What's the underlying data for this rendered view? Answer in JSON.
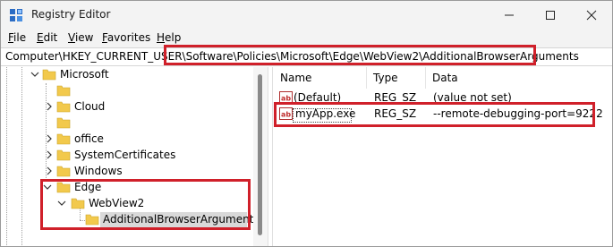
{
  "window": {
    "title": "Registry Editor",
    "app_icon": "registry-editor-icon"
  },
  "menu": {
    "items": [
      "File",
      "Edit",
      "View",
      "Favorites",
      "Help"
    ]
  },
  "address": {
    "path": "Computer\\HKEY_CURRENT_USER\\Software\\Policies\\Microsoft\\Edge\\WebView2\\AdditionalBrowserArguments"
  },
  "tree": {
    "items": [
      {
        "label": "Microsoft",
        "expanded": true
      },
      {
        "label": ""
      },
      {
        "label": "Cloud",
        "collapsed": true
      },
      {
        "label": ""
      },
      {
        "label": "office",
        "collapsed": true
      },
      {
        "label": "SystemCertificates",
        "collapsed": true
      },
      {
        "label": "Windows",
        "collapsed": true
      },
      {
        "label": "Edge",
        "expanded": true
      },
      {
        "label": "WebView2",
        "expanded": true
      },
      {
        "label": "AdditionalBrowserArguments",
        "selected": true
      }
    ]
  },
  "list": {
    "columns": [
      "Name",
      "Type",
      "Data"
    ],
    "rows": [
      {
        "name": "(Default)",
        "type": "REG_SZ",
        "data": "(value not set)",
        "icon": "string-value-icon"
      },
      {
        "name": "myApp.exe",
        "type": "REG_SZ",
        "data": "--remote-debugging-port=9222",
        "icon": "string-value-icon"
      }
    ]
  },
  "colors": {
    "highlight": "#d0202a",
    "folder": "#f2c94c",
    "selected_bg": "#d9d9d9"
  }
}
